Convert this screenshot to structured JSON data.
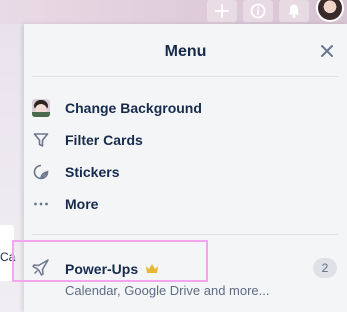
{
  "board": {
    "card_peek_text": "Ca"
  },
  "header": {
    "buttons": [
      {
        "icon": "plus-icon"
      },
      {
        "icon": "info-icon"
      },
      {
        "icon": "bell-icon"
      }
    ]
  },
  "menu": {
    "title": "Menu",
    "close_icon": "close-icon",
    "items": [
      {
        "label": "Change Background",
        "icon": "background-thumbnail"
      },
      {
        "label": "Filter Cards",
        "icon": "filter-icon"
      },
      {
        "label": "Stickers",
        "icon": "sticker-icon"
      },
      {
        "label": "More",
        "icon": "more-dots-icon"
      }
    ],
    "powerups": {
      "label": "Power-Ups",
      "icon": "rocket-icon",
      "premium_icon": "crown-icon",
      "subtitle": "Calendar, Google Drive and more...",
      "count": "2"
    }
  },
  "colors": {
    "highlight": "#f3a6ef",
    "text_primary": "#172b4d",
    "text_secondary": "#5e6c84",
    "crown": "#e6b634"
  }
}
